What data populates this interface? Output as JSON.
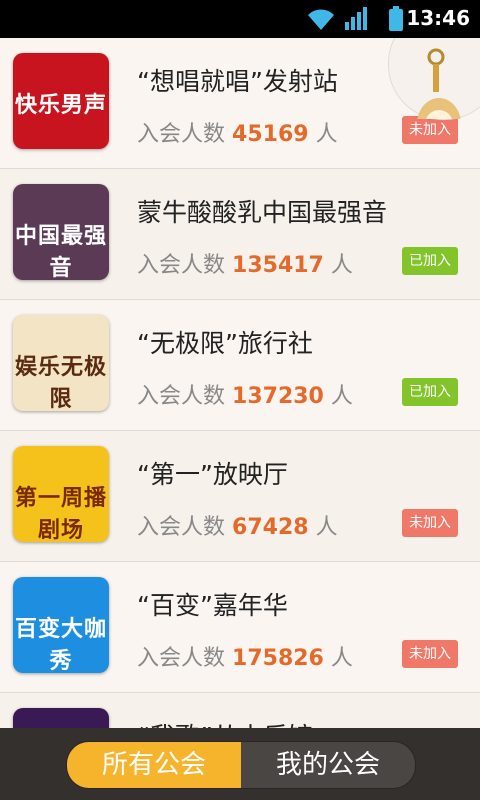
{
  "status": {
    "time": "13:46"
  },
  "list": {
    "member_prefix": "入会人数",
    "member_suffix": "人",
    "items": [
      {
        "name": "“想唱就唱”发射站",
        "count": "45169",
        "status": "未加入",
        "logo_text": "快乐男声",
        "logo_color": "#c8141e"
      },
      {
        "name": "蒙牛酸酸乳中国最强音",
        "count": "135417",
        "status": "已加入",
        "logo_text": "中国最强音",
        "logo_color": "#5a3a55"
      },
      {
        "name": "“无极限”旅行社",
        "count": "137230",
        "status": "已加入",
        "logo_text": "娱乐无极限",
        "logo_color": "#f3e4c6"
      },
      {
        "name": "“第一”放映厅",
        "count": "67428",
        "status": "未加入",
        "logo_text": "第一周播剧场",
        "logo_color": "#f5c21b"
      },
      {
        "name": "“百变”嘉年华",
        "count": "175826",
        "status": "未加入",
        "logo_text": "百变大咖秀",
        "logo_color": "#1e8fe0"
      },
      {
        "name": "“我歌”从小乐馆",
        "count": "",
        "status": "",
        "logo_text": "",
        "logo_color": "#3a1a55"
      }
    ]
  },
  "tabs": {
    "all": "所有公会",
    "mine": "我的公会"
  }
}
